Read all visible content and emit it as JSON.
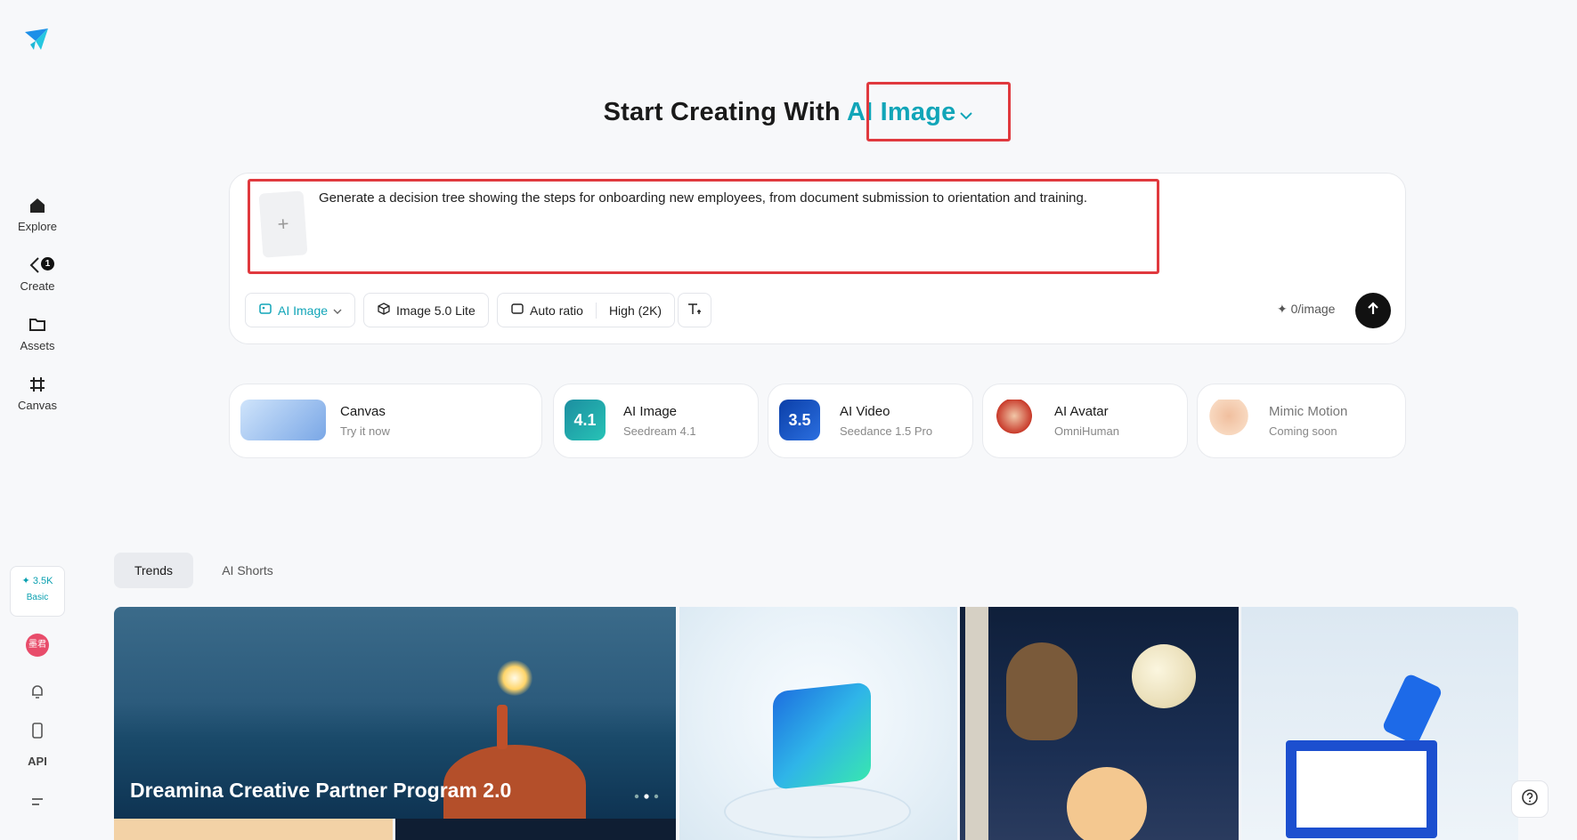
{
  "sidebar": {
    "logo": "dreamina-logo",
    "items": [
      {
        "label": "Explore",
        "icon": "home-icon"
      },
      {
        "label": "Create",
        "icon": "create-icon",
        "badge": "1"
      },
      {
        "label": "Assets",
        "icon": "folder-icon"
      },
      {
        "label": "Canvas",
        "icon": "canvas-icon"
      }
    ],
    "credits": {
      "amount": "3.5K",
      "level": "Basic"
    },
    "avatar_text": "墨君",
    "api_label": "API"
  },
  "heading": {
    "prefix": "Start Creating With",
    "mode": "AI Image"
  },
  "prompt": {
    "text": "Generate a decision tree showing the steps for onboarding new employees, from document submission to orientation and training.",
    "upload_symbol": "+"
  },
  "toolbar": {
    "mode_label": "AI Image",
    "model_label": "Image 5.0 Lite",
    "ratio_label": "Auto ratio",
    "quality_label": "High (2K)",
    "cost_label": "0/image"
  },
  "features": [
    {
      "title": "Canvas",
      "subtitle": "Try it now"
    },
    {
      "title": "AI Image",
      "subtitle": "Seedream 4.1",
      "badge": "4.1"
    },
    {
      "title": "AI Video",
      "subtitle": "Seedance 1.5 Pro",
      "badge": "3.5"
    },
    {
      "title": "AI Avatar",
      "subtitle": "OmniHuman"
    },
    {
      "title": "Mimic Motion",
      "subtitle": "Coming soon"
    }
  ],
  "tabs": [
    "Trends",
    "AI Shorts"
  ],
  "gallery": {
    "featured_caption": "Dreamina Creative Partner Program 2.0"
  },
  "colors": {
    "accent": "#11a5b8",
    "highlight": "#e0393e"
  }
}
